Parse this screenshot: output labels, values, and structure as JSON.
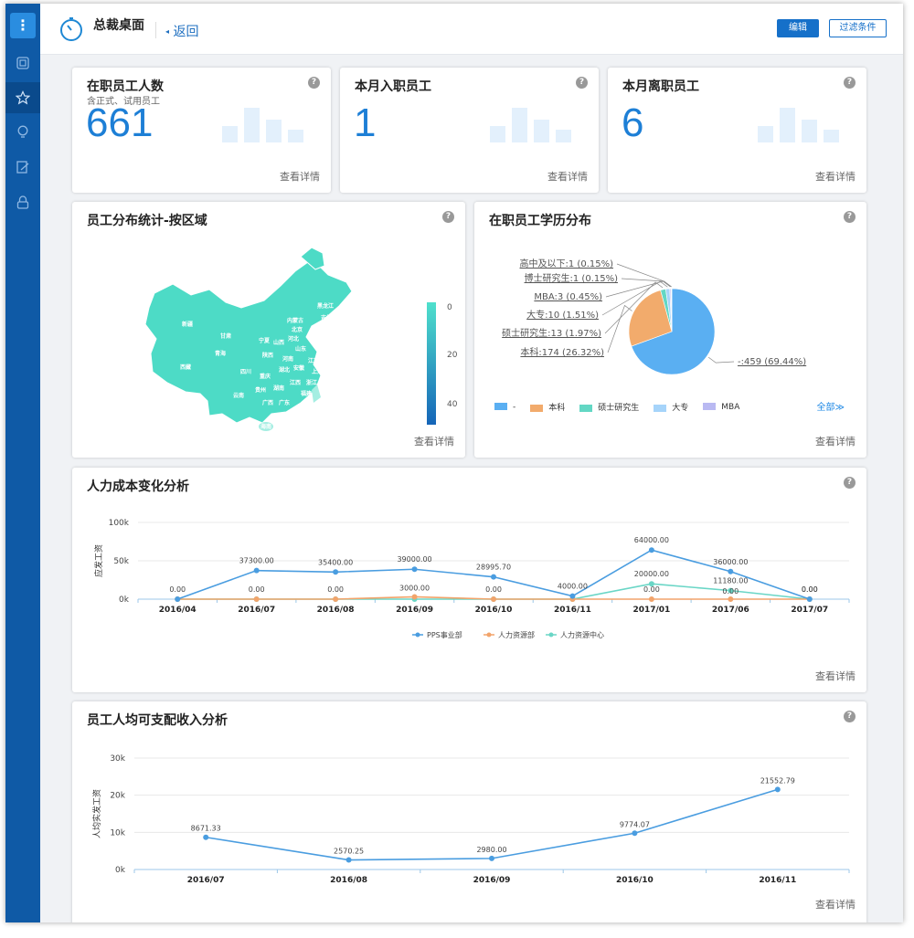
{
  "header": {
    "title": "总裁桌面",
    "back": "返回",
    "edit": "编辑",
    "filter": "过滤条件"
  },
  "common": {
    "more": "查看详情"
  },
  "kpis": [
    {
      "title": "在职员工人数",
      "sub": "含正式、试用员工",
      "value": "661"
    },
    {
      "title": "本月入职员工",
      "sub": "",
      "value": "1"
    },
    {
      "title": "本月离职员工",
      "sub": "",
      "value": "6"
    }
  ],
  "map": {
    "title": "员工分布统计-按区域",
    "scale_labels": [
      "0",
      "20",
      "40"
    ],
    "provinces": [
      "新疆",
      "西藏",
      "青海",
      "甘肃",
      "内蒙古",
      "黑龙江",
      "吉林",
      "辽宁",
      "北京",
      "河北",
      "山西",
      "宁夏",
      "陕西",
      "山东",
      "河南",
      "四川",
      "重庆",
      "湖北",
      "安徽",
      "江苏",
      "上海",
      "浙江",
      "贵州",
      "湖南",
      "江西",
      "福建",
      "云南",
      "广西",
      "广东",
      "台湾",
      "海南"
    ]
  },
  "education": {
    "title": "在职员工学历分布",
    "slices": [
      {
        "label": "高中及以下:1 (0.15%)",
        "value": 1
      },
      {
        "label": "博士研究生:1 (0.15%)",
        "value": 1
      },
      {
        "label": "MBA:3 (0.45%)",
        "value": 3
      },
      {
        "label": "大专:10 (1.51%)",
        "value": 10
      },
      {
        "label": "硕士研究生:13 (1.97%)",
        "value": 13
      },
      {
        "label": "本科:174 (26.32%)",
        "value": 174
      },
      {
        "label": "-:459 (69.44%)",
        "value": 459
      }
    ],
    "legend": [
      {
        "name": "-",
        "color": "#5aaff2"
      },
      {
        "name": "本科",
        "color": "#f2ab6c"
      },
      {
        "name": "硕士研究生",
        "color": "#63d7c4"
      },
      {
        "name": "大专",
        "color": "#a6d4fa"
      },
      {
        "name": "MBA",
        "color": "#b9b9f2"
      }
    ],
    "legend_more": "全部"
  },
  "labor": {
    "title": "人力成本变化分析",
    "ylabel": "应发工资"
  },
  "income": {
    "title": "员工人均可支配收入分析",
    "ylabel": "人均实发工资"
  },
  "chart_data": [
    {
      "type": "pie",
      "title": "在职员工学历分布",
      "categories": [
        "高中及以下",
        "博士研究生",
        "MBA",
        "大专",
        "硕士研究生",
        "本科",
        "-"
      ],
      "values": [
        1,
        1,
        3,
        10,
        13,
        174,
        459
      ],
      "colors": [
        "#f28f8f",
        "#f2d28a",
        "#b9b9f2",
        "#a6d4fa",
        "#63d7c4",
        "#f2ab6c",
        "#5aaff2"
      ]
    },
    {
      "type": "line",
      "title": "人力成本变化分析",
      "ylabel": "应发工资",
      "categories": [
        "2016/04",
        "2016/07",
        "2016/08",
        "2016/09",
        "2016/10",
        "2016/11",
        "2017/01",
        "2017/06",
        "2017/07"
      ],
      "yticks": [
        "0k",
        "50k",
        "100k"
      ],
      "ylim": [
        0,
        100000
      ],
      "series": [
        {
          "name": "PPS事业部",
          "color": "#4a9de0",
          "values": [
            0,
            37300,
            35400,
            39000,
            28995.7,
            4000,
            64000,
            36000,
            0
          ],
          "labels": [
            "0.00",
            "37300.00",
            "35400.00",
            "39000.00",
            "28995.70",
            "4000.00",
            "64000.00",
            "36000.00",
            "0.00"
          ]
        },
        {
          "name": "人力资源部",
          "color": "#f2a46b",
          "values": [
            0,
            0,
            0,
            3000,
            0,
            0,
            0,
            0,
            0
          ],
          "labels": [
            "",
            "",
            "",
            "3000.00",
            "",
            "",
            "0.00",
            "",
            ""
          ]
        },
        {
          "name": "人力资源中心",
          "color": "#6ad6c6",
          "values": [
            0,
            0,
            0,
            0,
            0,
            0,
            20000,
            11180,
            0
          ],
          "labels": [
            "",
            "0.00",
            "0.00",
            "",
            "0.00",
            "",
            "20000.00",
            "11180.00",
            ""
          ]
        }
      ],
      "extra_labels": [
        "0.00",
        "0.00"
      ]
    },
    {
      "type": "line",
      "title": "员工人均可支配收入分析",
      "ylabel": "人均实发工资",
      "categories": [
        "2016/07",
        "2016/08",
        "2016/09",
        "2016/10",
        "2016/11"
      ],
      "yticks": [
        "0k",
        "10k",
        "20k",
        "30k"
      ],
      "ylim": [
        0,
        30000
      ],
      "series": [
        {
          "name": "",
          "color": "#4a9de0",
          "values": [
            8671.33,
            2570.25,
            2980.0,
            9774.07,
            21552.79
          ],
          "labels": [
            "8671.33",
            "2570.25",
            "2980.00",
            "9774.07",
            "21552.79"
          ]
        }
      ]
    }
  ]
}
